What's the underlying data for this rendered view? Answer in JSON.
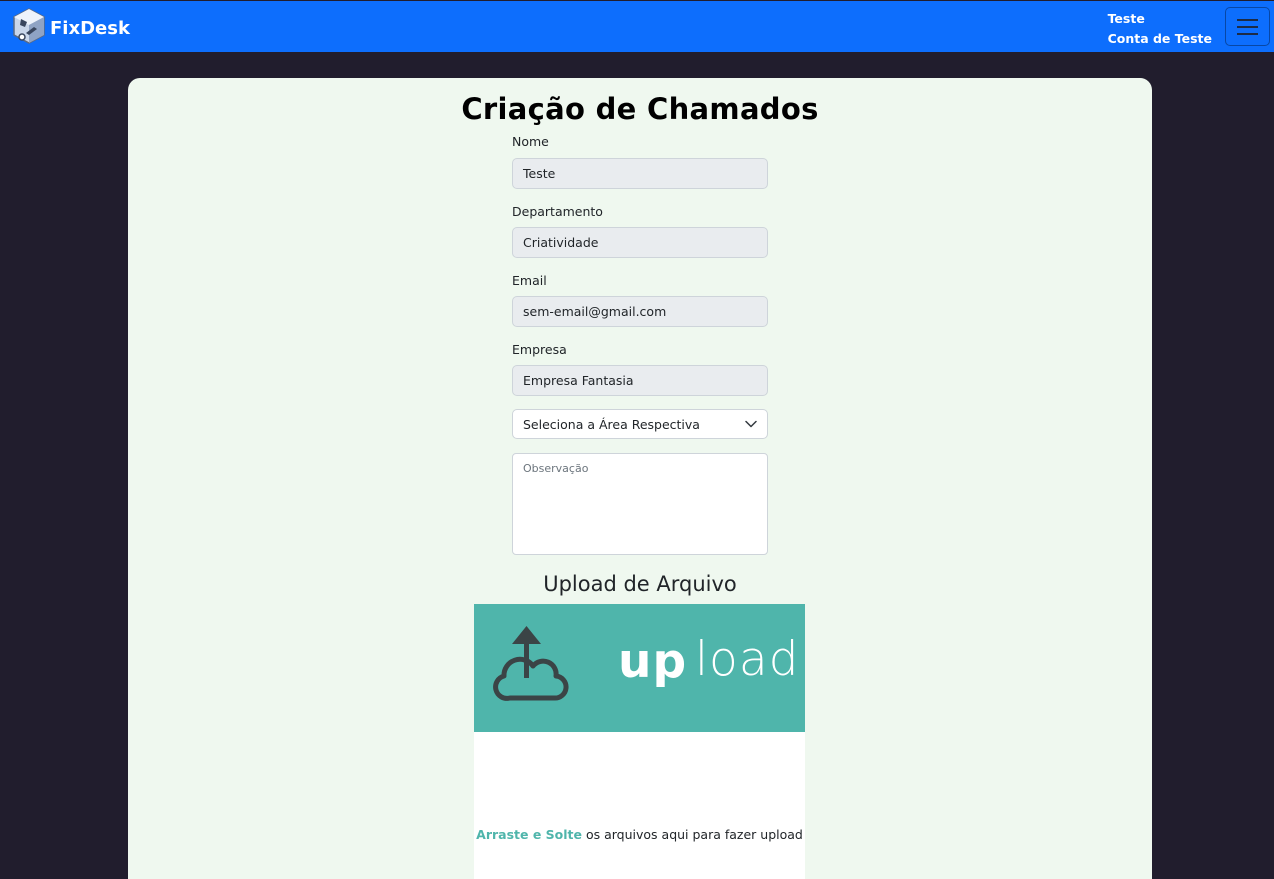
{
  "navbar": {
    "brand": "FixDesk",
    "user_name": "Teste",
    "user_account": "Conta de Teste"
  },
  "form": {
    "title": "Criação de Chamados",
    "fields": [
      {
        "label": "Nome",
        "value": "Teste"
      },
      {
        "label": "Departamento",
        "value": "Criatividade"
      },
      {
        "label": "Email",
        "value": "sem-email@gmail.com"
      },
      {
        "label": "Empresa",
        "value": "Empresa Fantasia"
      }
    ],
    "area_select": "Seleciona a Área Respectiva",
    "observation_placeholder": "Observação"
  },
  "upload": {
    "title": "Upload de Arquivo",
    "banner_bold": "up",
    "banner_light": "load",
    "drop_highlight": "Arraste e Solte",
    "drop_text": " os arquivos aqui para fazer upload"
  },
  "colors": {
    "navbar": "#0d6efd",
    "background": "#211d2d",
    "card": "#eff8ef",
    "upload_accent": "#4fb5ab"
  }
}
